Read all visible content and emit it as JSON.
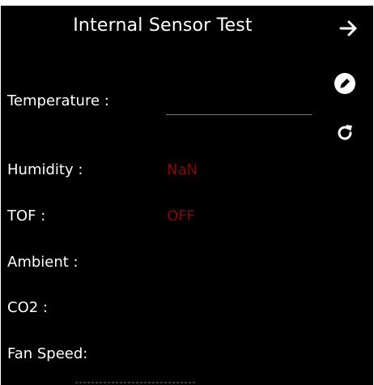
{
  "header": {
    "title": "Internal Sensor Test",
    "next_icon": "arrow-right-icon"
  },
  "actions": {
    "edit_icon": "pencil-icon",
    "refresh_icon": "refresh-icon"
  },
  "fields": [
    {
      "label": "Temperature :",
      "value": "",
      "input_placeholder": ""
    },
    {
      "label": "Humidity :",
      "value": "NaN"
    },
    {
      "label": "TOF :",
      "value": "OFF"
    },
    {
      "label": "Ambient :",
      "value": ""
    },
    {
      "label": "CO2 :",
      "value": ""
    },
    {
      "label": "Fan Speed:",
      "value": ""
    }
  ],
  "colors": {
    "background": "#000000",
    "text": "#ffffff",
    "status_value": "#8b0000",
    "input_underline": "#7a7a7a"
  }
}
